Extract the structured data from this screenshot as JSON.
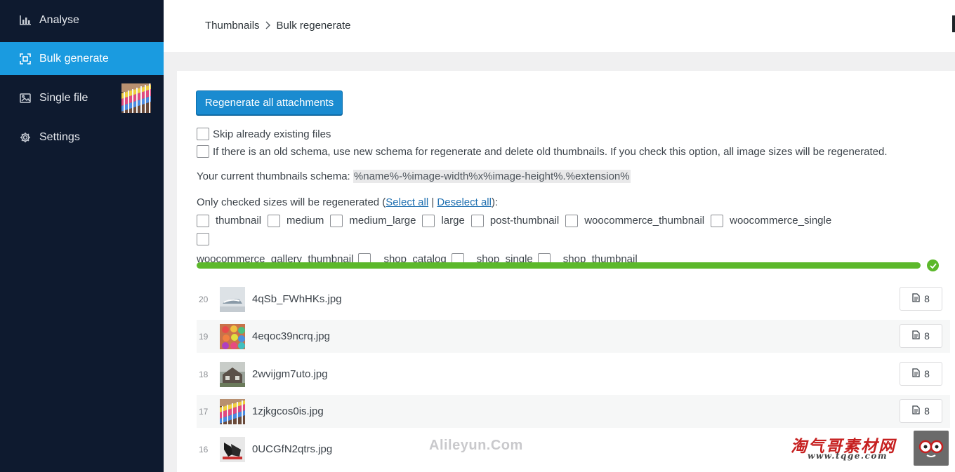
{
  "sidebar": {
    "items": [
      {
        "label": "Analyse",
        "icon": "bar-chart-icon",
        "active": false
      },
      {
        "label": "Bulk generate",
        "icon": "crop-frame-icon",
        "active": true
      },
      {
        "label": "Single file",
        "icon": "image-icon",
        "active": false
      },
      {
        "label": "Settings",
        "icon": "gear-icon",
        "active": false
      }
    ]
  },
  "header": {
    "breadcrumb": [
      "Thumbnails",
      "Bulk regenerate"
    ]
  },
  "main": {
    "regenerate_button": "Regenerate all attachments",
    "options": [
      {
        "label": "Skip already existing files",
        "checked": false
      },
      {
        "label": "If there is an old schema, use new schema for regenerate and delete old thumbnails. If you check this option, all image sizes will be regenerated.",
        "checked": false
      }
    ],
    "schema_label": "Your current thumbnails schema:",
    "schema_value": "%name%-%image-width%x%image-height%.%extension%",
    "sizes_prefix": "Only checked sizes will be regenerated (",
    "select_all": "Select all",
    "separator": "|",
    "deselect_all": "Deselect all",
    "sizes_suffix": "):",
    "sizes": [
      "thumbnail",
      "medium",
      "medium_large",
      "large",
      "post-thumbnail",
      "woocommerce_thumbnail",
      "woocommerce_single",
      "woocommerce_gallery_thumbnail",
      "shop_catalog",
      "shop_single",
      "shop_thumbnail"
    ],
    "progress": 1.0
  },
  "files": [
    {
      "id": "20",
      "name": "4qSb_FWhHKs.jpg",
      "count": "8"
    },
    {
      "id": "19",
      "name": "4eqoc39ncrq.jpg",
      "count": "8"
    },
    {
      "id": "18",
      "name": "2wvijgm7uto.jpg",
      "count": "8"
    },
    {
      "id": "17",
      "name": "1zjkgcos0is.jpg",
      "count": "8"
    },
    {
      "id": "16",
      "name": "0UCGfN2qtrs.jpg",
      "count": "8"
    }
  ],
  "watermarks": {
    "left": "Alileyun.Com",
    "right": "淘气哥素材网",
    "url": "www.tqge.com"
  },
  "colors": {
    "sidebar_bg": "#0e1a2f",
    "active_item": "#1a9be0",
    "button": "#1a8bd0",
    "progress": "#5cb82b"
  }
}
